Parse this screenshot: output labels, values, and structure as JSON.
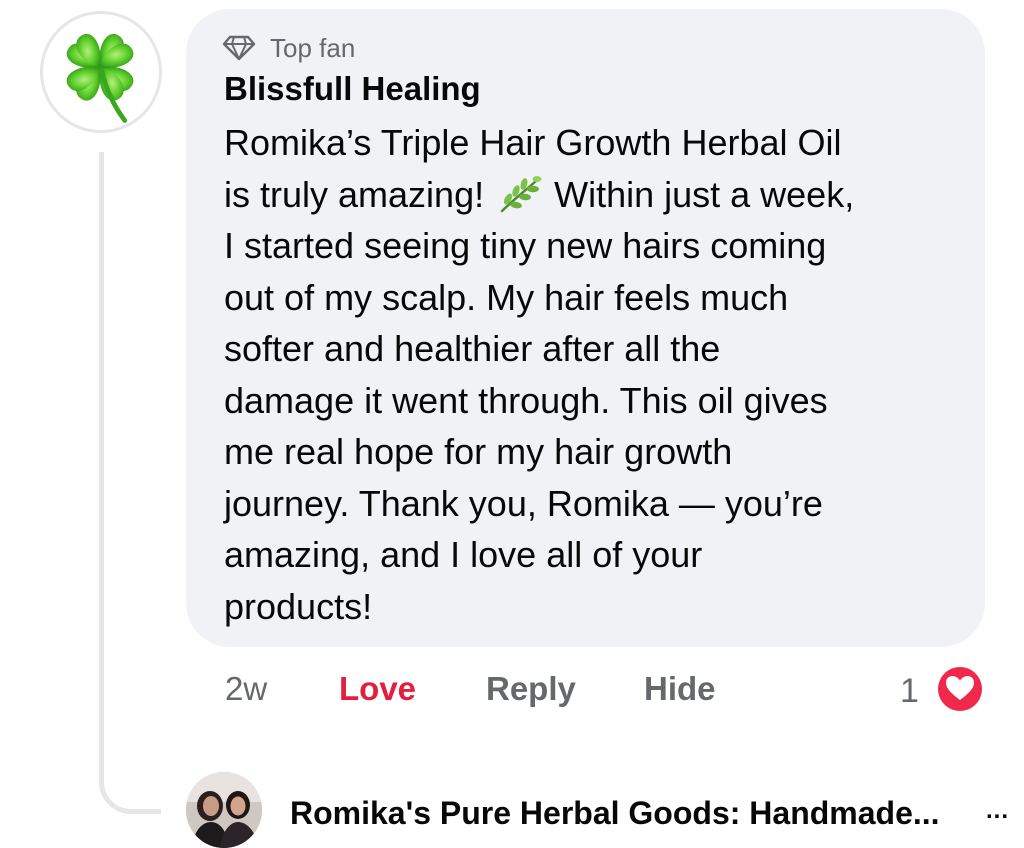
{
  "comment": {
    "badge_label": "Top fan",
    "badge_icon": "diamond-icon",
    "author": "Blissfull Healing",
    "text_lines": [
      "Romika’s Triple Hair Growth Herbal Oil",
      "is truly amazing! ",
      " Within just a week,",
      "I started seeing tiny new hairs coming",
      "out of my scalp. My hair feels much",
      "softer and healthier after all the",
      "damage it went through. This oil gives",
      "me real hope for my hair growth",
      "journey. Thank you, Romika — you’re",
      "amazing, and I love all of your",
      "products!"
    ],
    "emoji": "herb-emoji",
    "avatar": "four-leaf-clover"
  },
  "actions": {
    "time": "2w",
    "love_label": "Love",
    "reply_label": "Reply",
    "hide_label": "Hide",
    "reaction_count": "1",
    "reaction_icon": "love-reaction-icon"
  },
  "reply_preview": {
    "author": "Romika's Pure Herbal Goods: Handmade...",
    "more_label": "..."
  },
  "colors": {
    "bubble_bg": "#f0f2f5",
    "love_red": "#e41e3f",
    "secondary_text": "#65686c",
    "primary_text": "#080809",
    "thread_line": "#e4e6e9"
  }
}
